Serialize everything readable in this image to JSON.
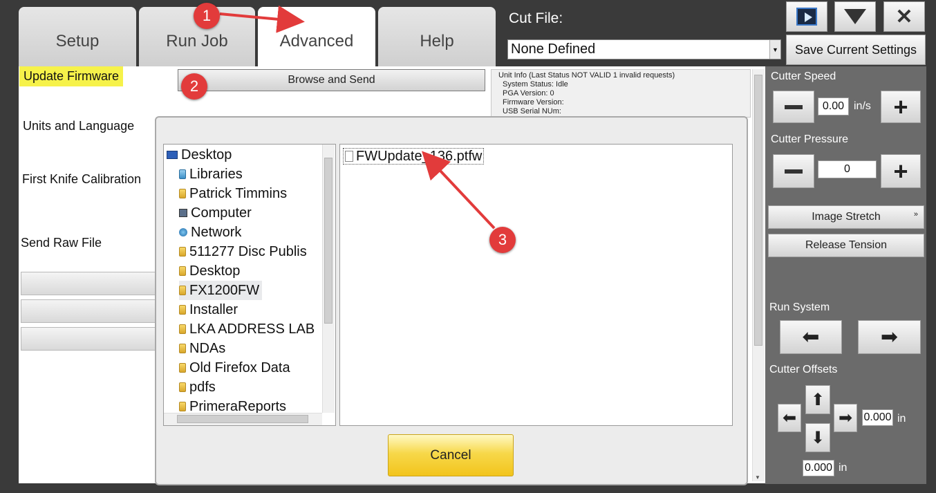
{
  "tabs": [
    {
      "label": "Setup"
    },
    {
      "label": "Run Job"
    },
    {
      "label": "Advanced"
    },
    {
      "label": "Help"
    }
  ],
  "left_menu": {
    "update_firmware": "Update Firmware",
    "units_language": "Units and Language",
    "first_knife": "First Knife Calibration",
    "send_raw": "Send Raw File"
  },
  "browse_button": "Browse and Send",
  "unit_info": {
    "header": "Unit Info (Last Status  NOT VALID 1 invalid requests)",
    "system_status": "System Status:  Idle",
    "pga_version": "PGA Version: 0",
    "firmware_version": "Firmware Version:",
    "usb_serial": "USB Serial NUm:"
  },
  "cut_file": {
    "label": "Cut File:",
    "value": "None Defined"
  },
  "save_button": "Save Current Settings",
  "window_buttons": {
    "play": "play-icon",
    "minimize": "chevron-down-icon",
    "close": "close-icon"
  },
  "cutter_speed": {
    "label": "Cutter Speed",
    "value": "0.00",
    "unit": "in/s"
  },
  "cutter_pressure": {
    "label": "Cutter Pressure",
    "value": "0"
  },
  "image_stretch": "Image Stretch",
  "release_tension": "Release Tension",
  "run_system": "Run System",
  "cutter_offsets": {
    "label": "Cutter Offsets",
    "x_value": "0.000",
    "x_unit": "in",
    "y_value": "0.000",
    "y_unit": "in"
  },
  "file_dialog": {
    "tree": [
      {
        "label": "Desktop",
        "icon": "desktop-icon"
      },
      {
        "label": "Libraries",
        "icon": "libraries-icon"
      },
      {
        "label": "Patrick Timmins",
        "icon": "user-icon"
      },
      {
        "label": "Computer",
        "icon": "computer-icon"
      },
      {
        "label": "Network",
        "icon": "network-icon"
      },
      {
        "label": "511277 Disc Publis",
        "icon": "folder-icon"
      },
      {
        "label": "Desktop",
        "icon": "folder-icon"
      },
      {
        "label": "FX1200FW",
        "icon": "folder-icon"
      },
      {
        "label": "Installer",
        "icon": "folder-icon"
      },
      {
        "label": "LKA ADDRESS LAB",
        "icon": "folder-icon"
      },
      {
        "label": "NDAs",
        "icon": "folder-icon"
      },
      {
        "label": "Old Firefox Data",
        "icon": "folder-icon"
      },
      {
        "label": "pdfs",
        "icon": "folder-icon"
      },
      {
        "label": "PrimeraReports",
        "icon": "folder-icon"
      }
    ],
    "file": "FWUpdate_136.ptfw",
    "cancel": "Cancel"
  },
  "annotations": [
    "1",
    "2",
    "3"
  ],
  "colors": {
    "highlight": "#f6f24a",
    "badge": "#e23b3b",
    "cancel": "#f2c41c",
    "panel": "#6b6b6b"
  }
}
